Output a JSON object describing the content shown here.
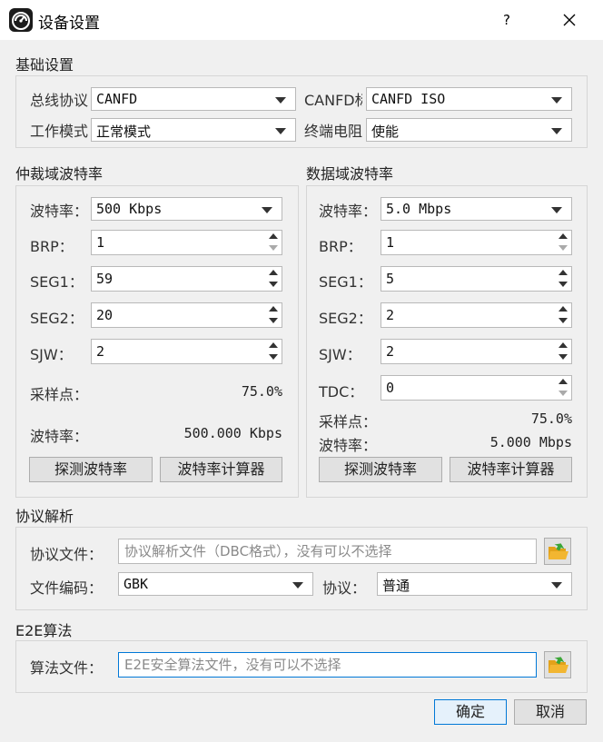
{
  "window": {
    "title": "设备设置",
    "help": "?"
  },
  "basic": {
    "title": "基础设置",
    "bus_protocol_label": "总线协议",
    "bus_protocol_value": "CANFD",
    "canfd_std_label": "CANFD标准",
    "canfd_std_value": "CANFD ISO",
    "work_mode_label": "工作模式",
    "work_mode_value": "正常模式",
    "term_res_label": "终端电阻",
    "term_res_value": "使能"
  },
  "arb": {
    "title": "仲裁域波特率",
    "baud_label": "波特率：",
    "baud_value": "500 Kbps",
    "brp_label": "BRP：",
    "brp_value": "1",
    "seg1_label": "SEG1：",
    "seg1_value": "59",
    "seg2_label": "SEG2：",
    "seg2_value": "20",
    "sjw_label": "SJW：",
    "sjw_value": "2",
    "sample_label": "采样点：",
    "sample_value": "75.0%",
    "rate_label": "波特率：",
    "rate_value": "500.000 Kbps",
    "detect_btn": "探测波特率",
    "calc_btn": "波特率计算器"
  },
  "data": {
    "title": "数据域波特率",
    "baud_label": "波特率：",
    "baud_value": "5.0 Mbps",
    "brp_label": "BRP：",
    "brp_value": "1",
    "seg1_label": "SEG1：",
    "seg1_value": "5",
    "seg2_label": "SEG2：",
    "seg2_value": "2",
    "sjw_label": "SJW：",
    "sjw_value": "2",
    "tdc_label": "TDC：",
    "tdc_value": "0",
    "sample_label": "采样点：",
    "sample_value": "75.0%",
    "rate_label": "波特率：",
    "rate_value": "5.000 Mbps",
    "detect_btn": "探测波特率",
    "calc_btn": "波特率计算器"
  },
  "protocol": {
    "title": "协议解析",
    "file_label": "协议文件：",
    "file_placeholder": "协议解析文件（DBC格式），没有可以不选择",
    "encoding_label": "文件编码：",
    "encoding_value": "GBK",
    "proto_label": "协议：",
    "proto_value": "普通"
  },
  "e2e": {
    "title": "E2E算法",
    "file_label": "算法文件：",
    "file_placeholder": "E2E安全算法文件，没有可以不选择"
  },
  "footer": {
    "ok": "确定",
    "cancel": "取消"
  },
  "colors": {
    "accent": "#0078d7",
    "folder": "#f2b631",
    "folder_arrow": "#3aa636"
  }
}
